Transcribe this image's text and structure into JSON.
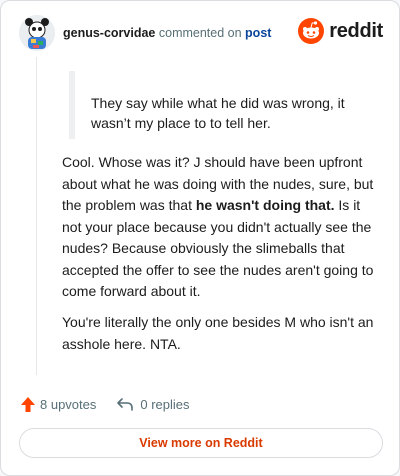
{
  "header": {
    "username": "genus-corvidae",
    "commented_on": "commented on",
    "post_link": "post",
    "brand": "reddit",
    "brand_color": "#ff4500"
  },
  "quote": {
    "text": "They say while what he did was wrong, it wasn’t my place to to tell her."
  },
  "comment": {
    "para1_before": "Cool. Whose was it? J should have been upfront about what he was doing with the nudes, sure, but the problem was that ",
    "para1_bold": "he wasn't doing that.",
    "para1_after": " Is it not your place because you didn't actually see the nudes? Because obviously the slimeballs that accepted the offer to see the nudes aren't going to come forward about it.",
    "para2": "You're literally the only one besides M who isn't an asshole here. NTA."
  },
  "actions": {
    "upvotes": "8 upvotes",
    "upvote_icon": "upvote-arrow-icon",
    "replies": "0 replies",
    "reply_icon": "reply-arrow-icon"
  },
  "view_more": "View more on Reddit",
  "colors": {
    "accent": "#d93a00",
    "upvote": "#ff4500",
    "link": "#0a449b",
    "muted": "#576f76"
  }
}
